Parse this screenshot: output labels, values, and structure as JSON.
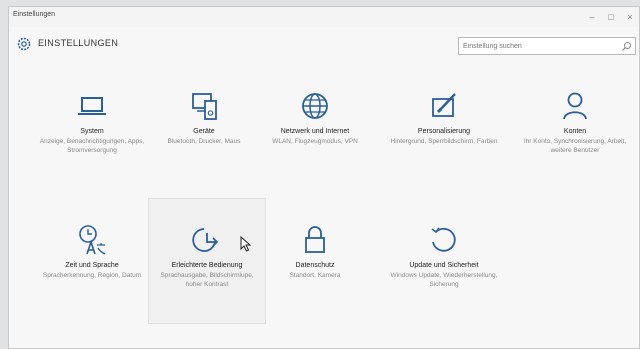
{
  "window": {
    "title": "Einstellungen",
    "minimize": "–",
    "maximize": "□",
    "close": "×"
  },
  "header": {
    "title": "EINSTELLUNGEN",
    "search_placeholder": "Einstellung suchen"
  },
  "tiles": [
    {
      "id": "system",
      "name": "System",
      "desc": "Anzeige, Benachrichtigungen, Apps, Stromversorgung",
      "icon": "laptop-icon"
    },
    {
      "id": "geraete",
      "name": "Geräte",
      "desc": "Bluetooth, Drucker, Maus",
      "icon": "devices-icon"
    },
    {
      "id": "netzwerk",
      "name": "Netzwerk und Internet",
      "desc": "WLAN, Flugzeugmodus, VPN",
      "icon": "globe-icon"
    },
    {
      "id": "personalisierung",
      "name": "Personalisierung",
      "desc": "Hintergrund, Sperrbildschirm, Farben",
      "icon": "paint-icon"
    },
    {
      "id": "konten",
      "name": "Konten",
      "desc": "Ihr Konto, Synchronisierung, Arbeit, weitere Benutzer",
      "icon": "person-icon"
    },
    {
      "id": "zeit",
      "name": "Zeit und Sprache",
      "desc": "Spracherkennung, Region, Datum",
      "icon": "time-language-icon"
    },
    {
      "id": "erleichterte",
      "name": "Erleichterte Bedienung",
      "desc": "Sprachausgabe, Bildschirmlupe, hoher Kontrast",
      "icon": "ease-of-access-icon"
    },
    {
      "id": "datenschutz",
      "name": "Datenschutz",
      "desc": "Standort, Kamera",
      "icon": "lock-icon"
    },
    {
      "id": "update",
      "name": "Update und Sicherheit",
      "desc": "Windows Update, Wiederherstellung, Sicherung",
      "icon": "refresh-icon"
    }
  ],
  "colors": {
    "accent": "#1a6fb5",
    "icon": "#2a5f9b"
  }
}
